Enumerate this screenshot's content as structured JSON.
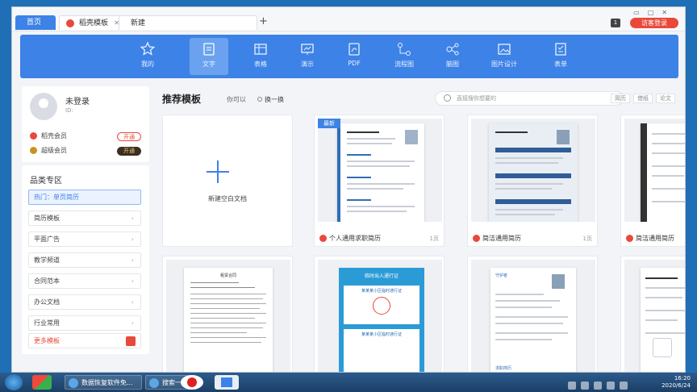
{
  "tabs": {
    "home": "首页",
    "templates": "稻壳模板",
    "new": "新建",
    "plus": "+"
  },
  "header": {
    "badge": "1",
    "visitor_login": "访客登录"
  },
  "toolbar": {
    "items": [
      {
        "label": "我的",
        "icon": "star-icon"
      },
      {
        "label": "文字",
        "icon": "document-icon"
      },
      {
        "label": "表格",
        "icon": "table-icon"
      },
      {
        "label": "演示",
        "icon": "presentation-icon"
      },
      {
        "label": "PDF",
        "icon": "pdf-icon"
      },
      {
        "label": "流程图",
        "icon": "flowchart-icon"
      },
      {
        "label": "脑图",
        "icon": "mindmap-icon"
      },
      {
        "label": "图片设计",
        "icon": "image-design-icon"
      },
      {
        "label": "表单",
        "icon": "form-icon"
      }
    ]
  },
  "user": {
    "name": "未登录",
    "id": "ID:",
    "members": [
      {
        "label": "稻壳会员",
        "button": "开通"
      },
      {
        "label": "超级会员",
        "button": "开通"
      }
    ]
  },
  "categories": {
    "title": "品类专区",
    "items": [
      "热门：单页简历",
      "简历模板",
      "平面广告",
      "教学频道",
      "合同范本",
      "办公文档",
      "行业常用",
      "更多模板"
    ]
  },
  "main": {
    "title": "推荐模板",
    "maybe": "你可以",
    "swap": "换一换",
    "search_placeholder": "直接搜你想要的",
    "chips": [
      "简历",
      "借纸",
      "论文"
    ],
    "blank_label": "新建空白文档",
    "new_tag": "最新",
    "templates": [
      {
        "name": "个人通用求职简历",
        "pages": "1页"
      },
      {
        "name": "简洁通用简历",
        "pages": "1页"
      },
      {
        "name": "简洁通用简历",
        "pages": ""
      }
    ],
    "cert_title": "临时出入通行证",
    "cert_line": "某某某小区临时通行证",
    "contract_title": "租赁合同",
    "resume_title": "守护者",
    "footer_brand": "求职简历"
  },
  "taskbar": {
    "tasks": [
      "数据恢复软件免...",
      "搜索一下"
    ],
    "time": "16:20",
    "date": "2020/6/24"
  },
  "colors": {
    "accent": "#3d82e6",
    "brand_red": "#e8493a",
    "cert_blue": "#2b9bd6"
  }
}
